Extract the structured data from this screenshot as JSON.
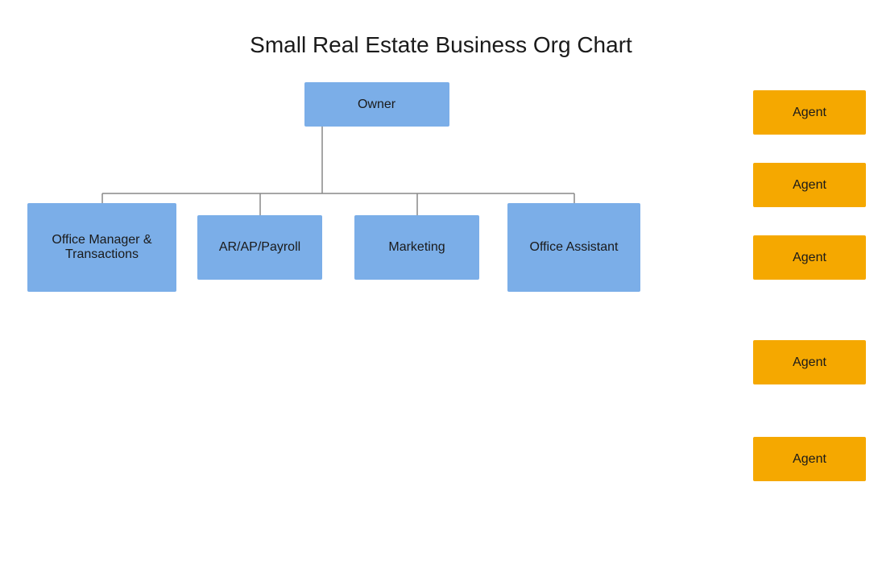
{
  "title": "Small Real Estate Business Org Chart",
  "nodes": {
    "owner": "Owner",
    "office_manager": "Office Manager & Transactions",
    "arap": "AR/AP/Payroll",
    "marketing": "Marketing",
    "office_assistant": "Office Assistant",
    "agents": [
      "Agent",
      "Agent",
      "Agent",
      "Agent",
      "Agent"
    ]
  },
  "colors": {
    "blue": "#7baee8",
    "orange": "#f5a800"
  }
}
